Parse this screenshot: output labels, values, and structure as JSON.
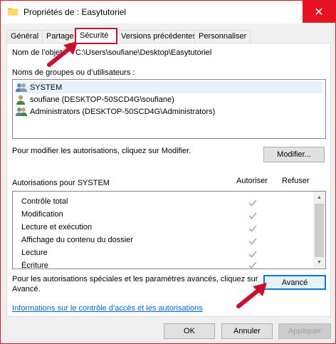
{
  "window": {
    "title": "Propriétés de : Easytutoriel",
    "close_glyph": "✕"
  },
  "tabs": [
    {
      "label": "Général"
    },
    {
      "label": "Partage"
    },
    {
      "label": "Sécurité"
    },
    {
      "label": "Versions précédentes"
    },
    {
      "label": "Personnaliser"
    }
  ],
  "object": {
    "label": "Nom de l’objet :",
    "value": "C:\\Users\\soufiane\\Desktop\\Easytutoriel"
  },
  "groups": {
    "label": "Noms de groupes ou d’utilisateurs :",
    "items": [
      {
        "name": "SYSTEM",
        "icon": "users-group-icon"
      },
      {
        "name": "soufiane (DESKTOP-50SCD4G\\soufiane)",
        "icon": "user-icon"
      },
      {
        "name": "Administrators (DESKTOP-50SCD4G\\Administrators)",
        "icon": "users-group-icon"
      }
    ]
  },
  "modify": {
    "text": "Pour modifier les autorisations, cliquez sur Modifier.",
    "button": "Modifier..."
  },
  "permissions": {
    "label": "Autorisations pour SYSTEM",
    "col_allow": "Autoriser",
    "col_deny": "Refuser",
    "items": [
      {
        "name": "Contrôle total",
        "allow": true,
        "deny": false
      },
      {
        "name": "Modification",
        "allow": true,
        "deny": false
      },
      {
        "name": "Lecture et exécution",
        "allow": true,
        "deny": false
      },
      {
        "name": "Affichage du contenu du dossier",
        "allow": true,
        "deny": false
      },
      {
        "name": "Lecture",
        "allow": true,
        "deny": false
      },
      {
        "name": "Écriture",
        "allow": true,
        "deny": false
      }
    ]
  },
  "advanced": {
    "text_line1": "Pour les autorisations spéciales et les paramètres avancés, cliquez sur",
    "text_line2": "Avancé.",
    "button": "Avancé"
  },
  "link": "Informations sur le contrôle d’accès et les autorisations",
  "footer": {
    "ok": "OK",
    "cancel": "Annuler",
    "apply": "Appliquer"
  },
  "colors": {
    "accent_red": "#c8102e",
    "focus_blue": "#0078d7",
    "link_blue": "#0066cc"
  }
}
